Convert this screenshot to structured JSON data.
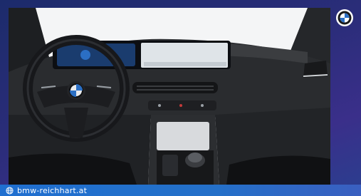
{
  "footer": {
    "website": "bmw-reichhart.at",
    "icon": "globe-icon"
  },
  "brand": {
    "logo": "bmw-roundel",
    "accent": "#1f6fd0",
    "frame_color": "#2b2d7a"
  },
  "photo": {
    "subject": "bmw-interior-dashboard"
  }
}
